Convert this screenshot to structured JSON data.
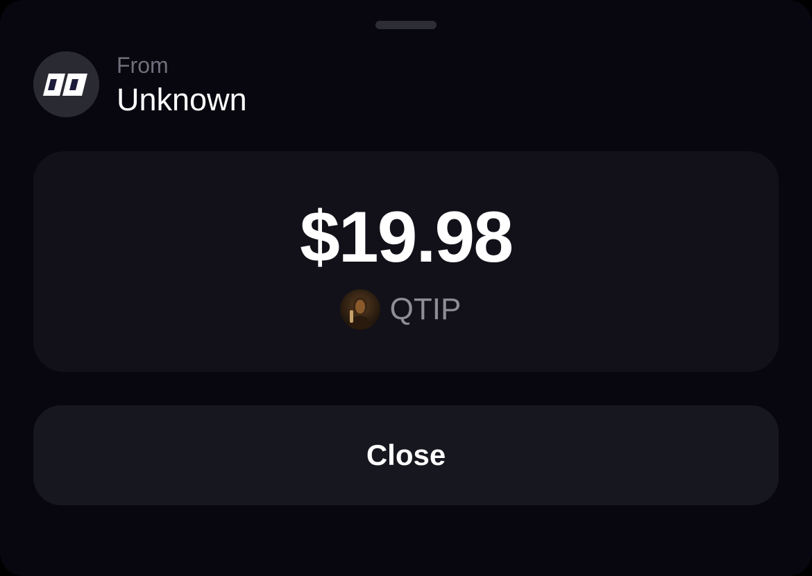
{
  "sheet": {
    "handle": "drag-handle"
  },
  "sender": {
    "label": "From",
    "name": "Unknown",
    "avatar_icon": "app-logo-icon"
  },
  "transfer": {
    "amount": "$19.98",
    "token_symbol": "QTIP",
    "token_icon": "token-avatar-icon"
  },
  "actions": {
    "close_label": "Close"
  },
  "colors": {
    "background": "#08070f",
    "card": "#121119",
    "button": "#171720",
    "muted_text": "#6f6f7c",
    "text": "#ffffff"
  }
}
